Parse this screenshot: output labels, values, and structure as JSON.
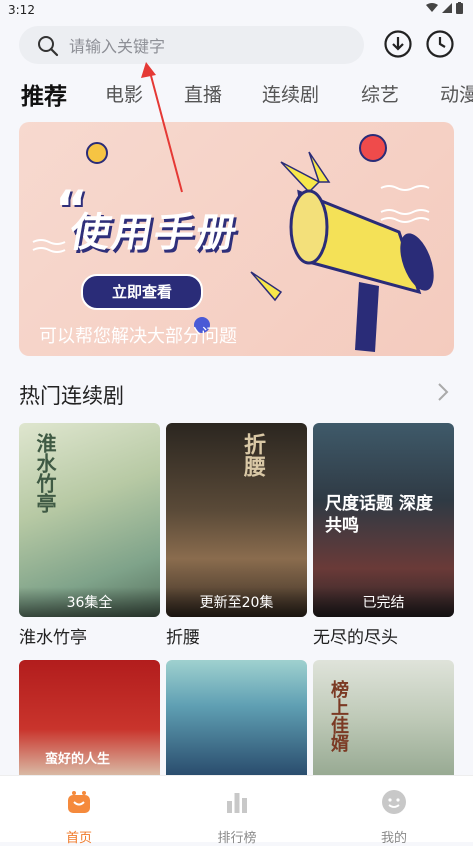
{
  "status_bar": {
    "time": "3:12"
  },
  "search": {
    "placeholder": "请输入关键字",
    "value": ""
  },
  "tabs": [
    {
      "label": "推荐",
      "active": true
    },
    {
      "label": "电影"
    },
    {
      "label": "直播"
    },
    {
      "label": "连续剧"
    },
    {
      "label": "综艺"
    },
    {
      "label": "动漫"
    }
  ],
  "banner": {
    "title": "使用手册",
    "quote_mark": "“",
    "button_label": "立即查看",
    "subtitle": "可以帮您解决大部分问题"
  },
  "section": {
    "title": "热门连续剧"
  },
  "shows": [
    {
      "poster_title": "淮水竹亭",
      "badge": "36集全",
      "name": "淮水竹亭"
    },
    {
      "poster_title": "折腰",
      "badge": "更新至20集",
      "name": "折腰"
    },
    {
      "poster_title": "尺度话题 深度共鸣",
      "badge": "已完结",
      "name": "无尽的尽头"
    },
    {
      "poster_title": "蛮好的人生",
      "badge": "",
      "name": ""
    },
    {
      "poster_title": "",
      "badge": "",
      "name": ""
    },
    {
      "poster_title": "榜上佳婿",
      "badge": "",
      "name": ""
    }
  ],
  "bottom_nav": [
    {
      "label": "首页",
      "icon": "home-icon",
      "active": true
    },
    {
      "label": "排行榜",
      "icon": "chart-icon"
    },
    {
      "label": "我的",
      "icon": "profile-icon"
    }
  ],
  "colors": {
    "accent": "#f07a2a",
    "banner_button": "#2a2c78",
    "annotation_arrow": "#e53935"
  }
}
